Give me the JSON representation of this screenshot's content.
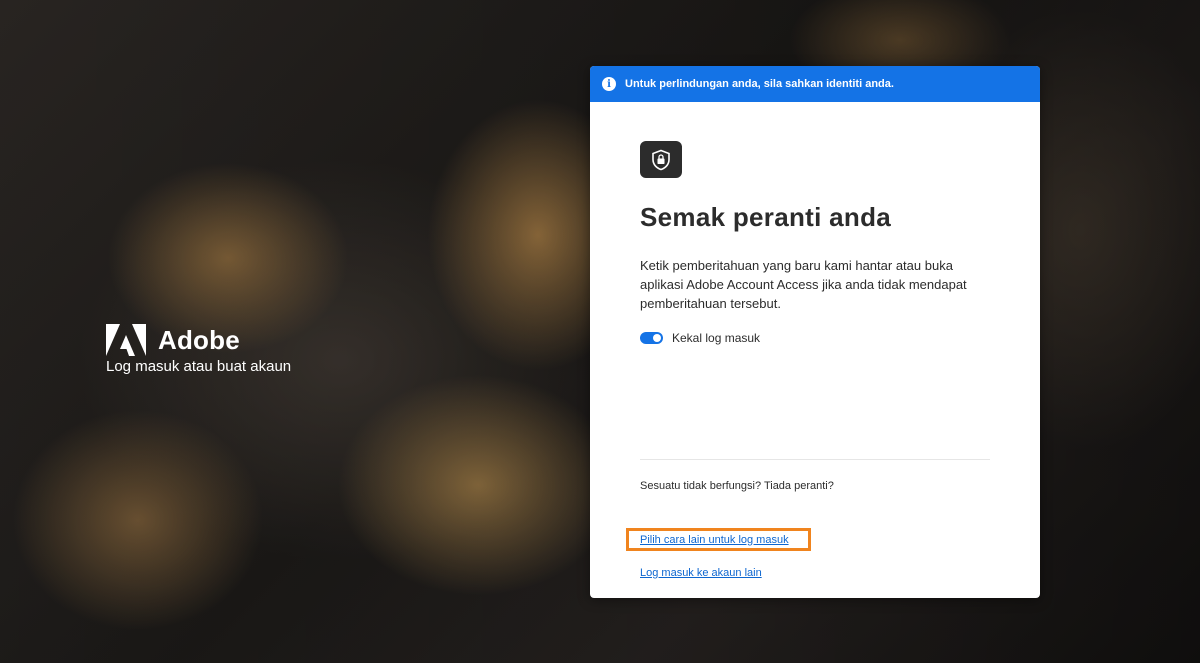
{
  "brand": {
    "name": "Adobe",
    "subtitle": "Log masuk atau buat akaun"
  },
  "banner": {
    "icon": "info-icon",
    "text": "Untuk perlindungan anda, sila sahkan identiti anda."
  },
  "card": {
    "icon": "device-shield-icon",
    "title": "Semak peranti anda",
    "description": "Ketik pemberitahuan yang baru kami hantar atau buka aplikasi Adobe Account Access jika anda tidak mendapat pemberitahuan tersebut.",
    "toggle": {
      "label": "Kekal log masuk",
      "checked": true
    },
    "help_text": "Sesuatu tidak berfungsi? Tiada peranti?",
    "alt_method_link": "Pilih cara lain untuk log masuk",
    "other_account_link": "Log masuk ke akaun lain"
  },
  "colors": {
    "accent": "#1473e6",
    "link": "#0d66d0",
    "highlight": "#f0841e"
  }
}
